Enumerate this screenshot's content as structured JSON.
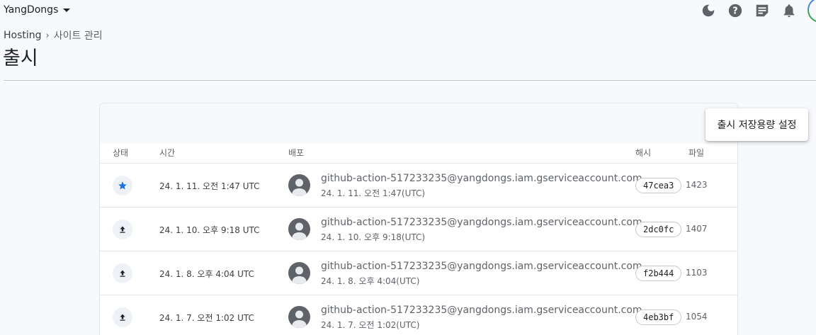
{
  "header": {
    "project_name": "YangDongs",
    "icons": [
      "dark-mode-icon",
      "help-icon",
      "notes-icon",
      "notifications-icon"
    ]
  },
  "breadcrumb": {
    "root": "Hosting",
    "separator": "›",
    "current": "사이트 관리"
  },
  "page": {
    "title": "출시"
  },
  "popup": {
    "label": "출시 저장용량 설정"
  },
  "table": {
    "columns": {
      "status": "상태",
      "time": "시간",
      "deploy": "배포",
      "hash": "해시",
      "files": "파일"
    },
    "rows": [
      {
        "status_icon": "star-icon",
        "time": "24. 1. 11. 오전 1:47 UTC",
        "email": "github-action-517233235@yangdongs.iam.gserviceaccount.com",
        "deploy_time": "24. 1. 11. 오전 1:47(UTC)",
        "hash": "47cea3",
        "files": "1423"
      },
      {
        "status_icon": "upload-icon",
        "time": "24. 1. 10. 오후 9:18 UTC",
        "email": "github-action-517233235@yangdongs.iam.gserviceaccount.com",
        "deploy_time": "24. 1. 10. 오후 9:18(UTC)",
        "hash": "2dc0fc",
        "files": "1407"
      },
      {
        "status_icon": "upload-icon",
        "time": "24. 1. 8. 오후 4:04 UTC",
        "email": "github-action-517233235@yangdongs.iam.gserviceaccount.com",
        "deploy_time": "24. 1. 8. 오후 4:04(UTC)",
        "hash": "f2b444",
        "files": "1103"
      },
      {
        "status_icon": "upload-icon",
        "time": "24. 1. 7. 오전 1:02 UTC",
        "email": "github-action-517233235@yangdongs.iam.gserviceaccount.com",
        "deploy_time": "24. 1. 7. 오전 1:02(UTC)",
        "hash": "4eb3bf",
        "files": "1054"
      }
    ]
  },
  "colors": {
    "accent": "#1a73e8",
    "icon": "#5f6368",
    "background": "#f8f9fc"
  }
}
